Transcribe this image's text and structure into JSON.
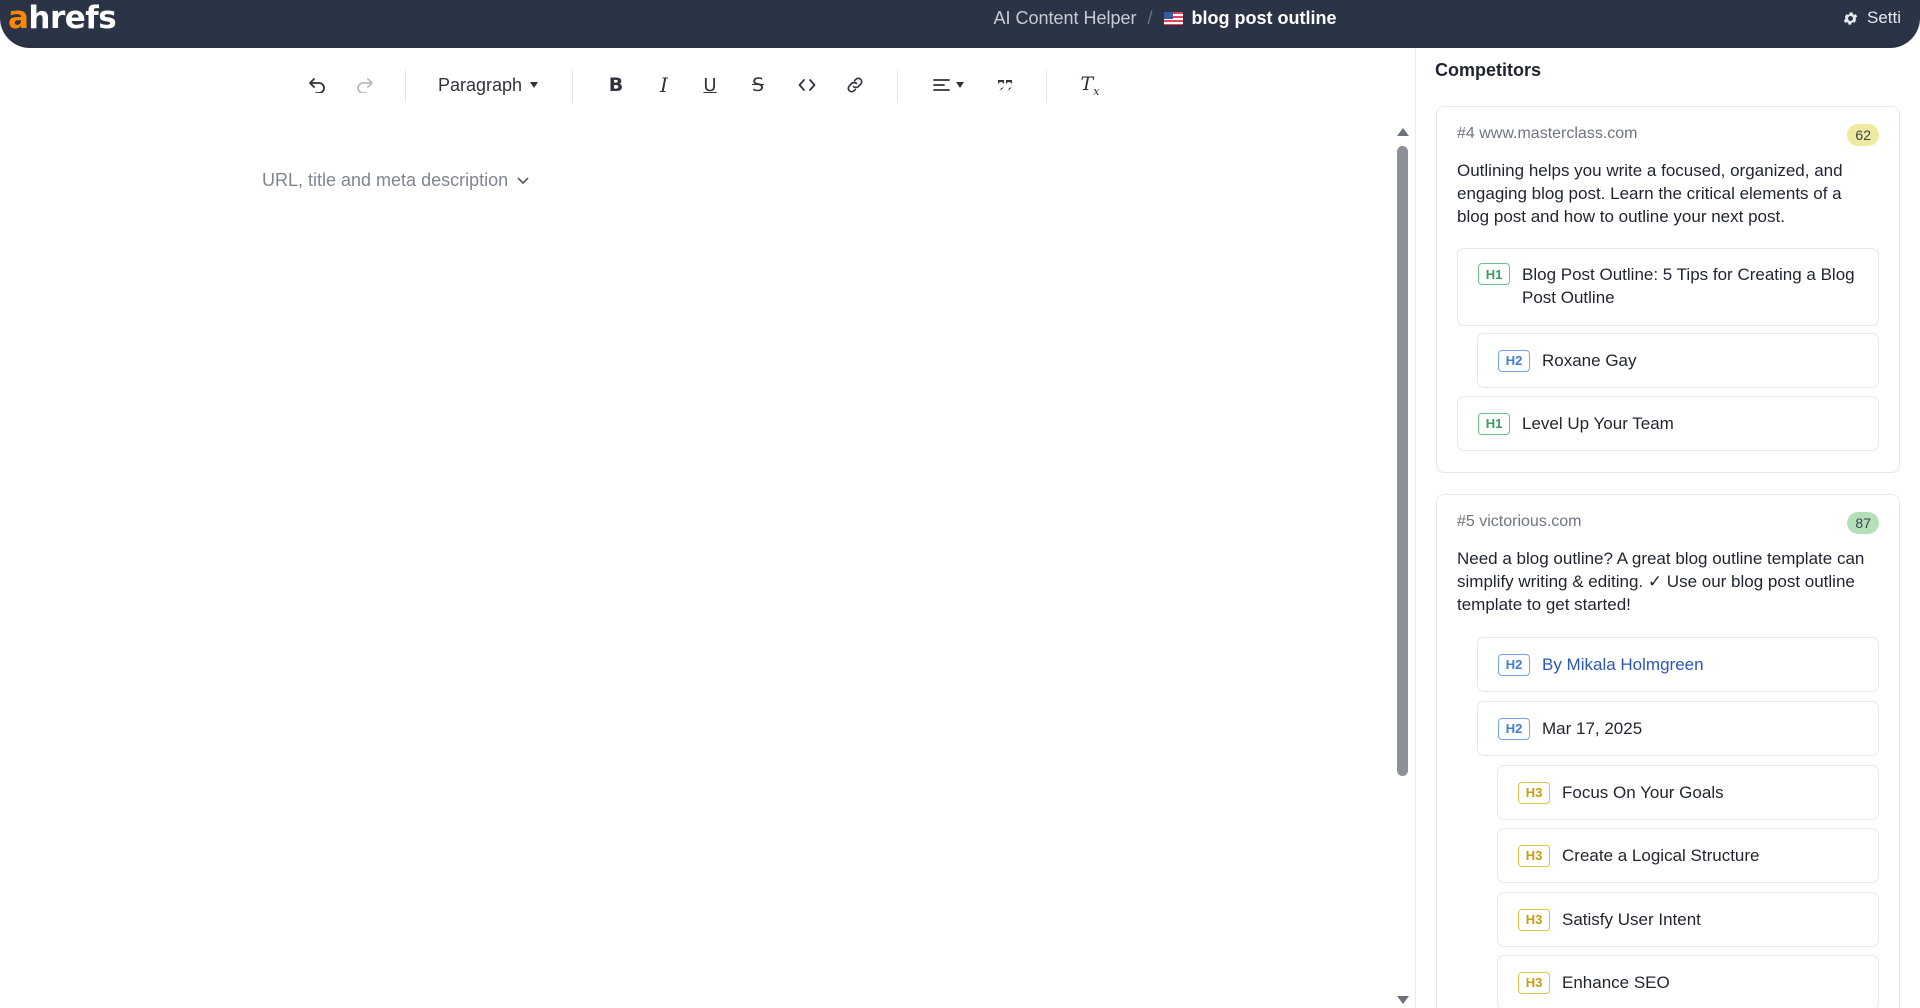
{
  "topbar": {
    "logo_accent": "a",
    "logo_rest": "hrefs",
    "app_name": "AI Content Helper",
    "separator": "/",
    "document_title": "blog post outline",
    "settings_label": "Setti"
  },
  "toolbar": {
    "paragraph_label": "Paragraph",
    "bold_glyph": "B",
    "italic_glyph": "I",
    "underline_glyph": "U",
    "strike_glyph": "S",
    "clear_glyph": "T",
    "clear_sub": "x"
  },
  "editor": {
    "meta_toggle": "URL, title and meta description"
  },
  "competitors": {
    "title": "Competitors",
    "items": [
      {
        "host": "#4 www.masterclass.com",
        "score": "62",
        "score_color": "#eeeba0",
        "description": "Outlining helps you write a focused, organized, and engaging blog post. Learn the critical elements of a blog post and how to outline your next post.",
        "headings": [
          {
            "level": "H1",
            "text": "Blog Post Outline: 5 Tips for Creating a Blog Post Outline"
          },
          {
            "level": "H2",
            "text": "Roxane Gay"
          },
          {
            "level": "H1",
            "text": "Level Up Your Team"
          }
        ]
      },
      {
        "host": "#5 victorious.com",
        "score": "87",
        "score_color": "#b3e0b8",
        "description": "Need a blog outline? A great blog outline template can simplify writing & editing. ✓ Use our blog post outline template to get started!",
        "headings": [
          {
            "level": "H2",
            "text": "By Mikala Holmgreen"
          },
          {
            "level": "H2",
            "text": "Mar 17, 2025"
          },
          {
            "level": "H3",
            "text": "Focus On Your Goals"
          },
          {
            "level": "H3",
            "text": "Create a Logical Structure"
          },
          {
            "level": "H3",
            "text": "Satisfy User Intent"
          },
          {
            "level": "H3",
            "text": "Enhance SEO"
          }
        ]
      }
    ]
  }
}
